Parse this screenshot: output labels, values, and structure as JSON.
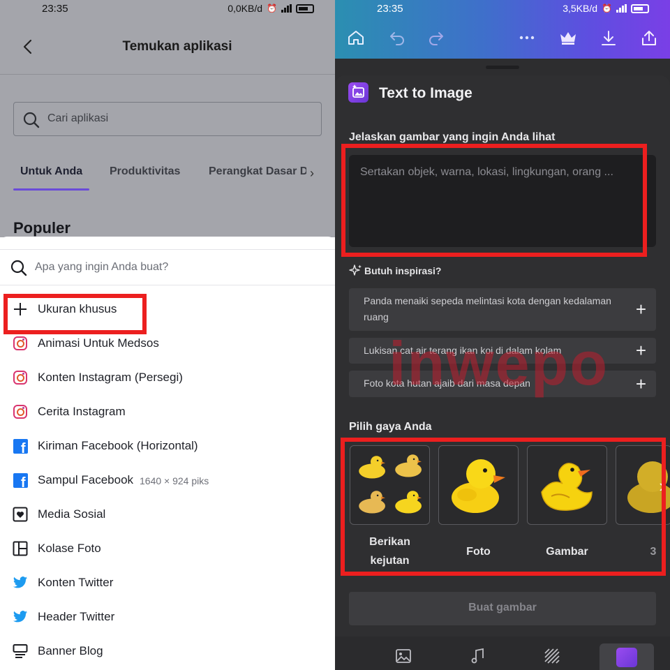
{
  "left": {
    "status_bar": {
      "time": "23:35",
      "net_speed": "0,0KB/d"
    },
    "header": {
      "title": "Temukan aplikasi"
    },
    "search": {
      "placeholder": "Cari aplikasi"
    },
    "tabs": [
      "Untuk Anda",
      "Produktivitas",
      "Perangkat Dasar D"
    ],
    "section_title": "Populer",
    "sheet": {
      "search_placeholder": "Apa yang ingin Anda buat?",
      "items": [
        {
          "icon": "plus-icon",
          "label": "Ukuran khusus"
        },
        {
          "icon": "instagram-icon",
          "label": "Animasi Untuk Medsos"
        },
        {
          "icon": "instagram-icon",
          "label": "Konten Instagram (Persegi)"
        },
        {
          "icon": "instagram-icon",
          "label": "Cerita Instagram"
        },
        {
          "icon": "facebook-icon",
          "label": "Kiriman Facebook (Horizontal)"
        },
        {
          "icon": "facebook-icon",
          "label": "Sampul Facebook",
          "sub": "1640 × 924 piks"
        },
        {
          "icon": "heart-frame-icon",
          "label": "Media Sosial"
        },
        {
          "icon": "collage-icon",
          "label": "Kolase Foto"
        },
        {
          "icon": "twitter-icon",
          "label": "Konten Twitter"
        },
        {
          "icon": "twitter-icon",
          "label": "Header Twitter"
        },
        {
          "icon": "banner-icon",
          "label": "Banner Blog"
        }
      ]
    }
  },
  "right": {
    "status_bar": {
      "time": "23:35",
      "net_speed": "3,5KB/d"
    },
    "panel_title": "Text to Image",
    "description_label": "Jelaskan gambar yang ingin Anda lihat",
    "description_placeholder": "Sertakan objek, warna, lokasi, lingkungan, orang ...",
    "inspiration_label": "Butuh inspirasi?",
    "suggestions": [
      "Panda menaiki sepeda melintasi kota dengan kedalaman ruang",
      "Lukisan cat air terang ikan koi di dalam kolam",
      "Foto kota hutan ajaib dari masa depan"
    ],
    "style_label": "Pilih gaya Anda",
    "styles": [
      "Berikan kejutan",
      "Foto",
      "Gambar",
      "3"
    ],
    "create_button": "Buat gambar",
    "watermark": "inwepo"
  },
  "colors": {
    "highlight_red": "#ec1f1f",
    "accent_purple": "#6a4bd8",
    "facebook_blue": "#1877f2",
    "twitter_blue": "#1d9bf0"
  }
}
